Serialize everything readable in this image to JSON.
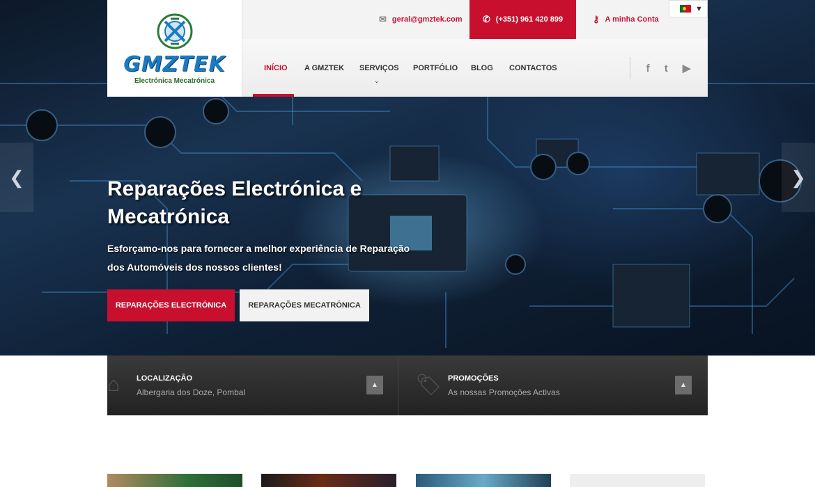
{
  "brand": {
    "name": "GMZTEK",
    "tagline": "Electrónica Mecatrónica"
  },
  "topbar": {
    "email": "geral@gmztek.com",
    "phone": "(+351) 961 420 899",
    "account": "A minha Conta",
    "email_icon": "envelope-icon",
    "phone_icon": "phone-icon",
    "account_icon": "key-icon"
  },
  "language": {
    "selected": "pt",
    "flag_icon": "portugal-flag-icon"
  },
  "nav": {
    "items": [
      {
        "label": "INÍCIO",
        "active": true
      },
      {
        "label": "A GMZTEK"
      },
      {
        "label": "SERVIÇOS",
        "has_dropdown": true
      },
      {
        "label": "PORTFÓLIO"
      },
      {
        "label": "BLOG"
      },
      {
        "label": "CONTACTOS"
      }
    ]
  },
  "social": [
    {
      "icon": "facebook-icon",
      "glyph": "f"
    },
    {
      "icon": "twitter-icon",
      "glyph": "t"
    },
    {
      "icon": "youtube-icon",
      "glyph": "▶"
    }
  ],
  "hero": {
    "title_line1": "Reparações Electrónica e",
    "title_line2": "Mecatrónica",
    "description": "Esforçamo-nos para fornecer a melhor experiência de Reparação dos Automóveis dos nossos clientes!",
    "btn_primary": "REPARAÇÕES ELECTRÓNICA",
    "btn_secondary": "REPARAÇÕES MECATRÓNICA",
    "prev_glyph": "❮",
    "next_glyph": "❯"
  },
  "info": [
    {
      "icon": "home-icon",
      "glyph": "⌂",
      "title": "LOCALIZAÇÃO",
      "text": "Albergaria dos Doze, Pombal"
    },
    {
      "icon": "tags-icon",
      "glyph": "🏷",
      "title": "PROMOÇÕES",
      "text": "As nossas Promoções Activas"
    }
  ],
  "colors": {
    "accent": "#c8102e",
    "dark": "#2a2a2a",
    "brand_blue": "#1a7bc4"
  }
}
